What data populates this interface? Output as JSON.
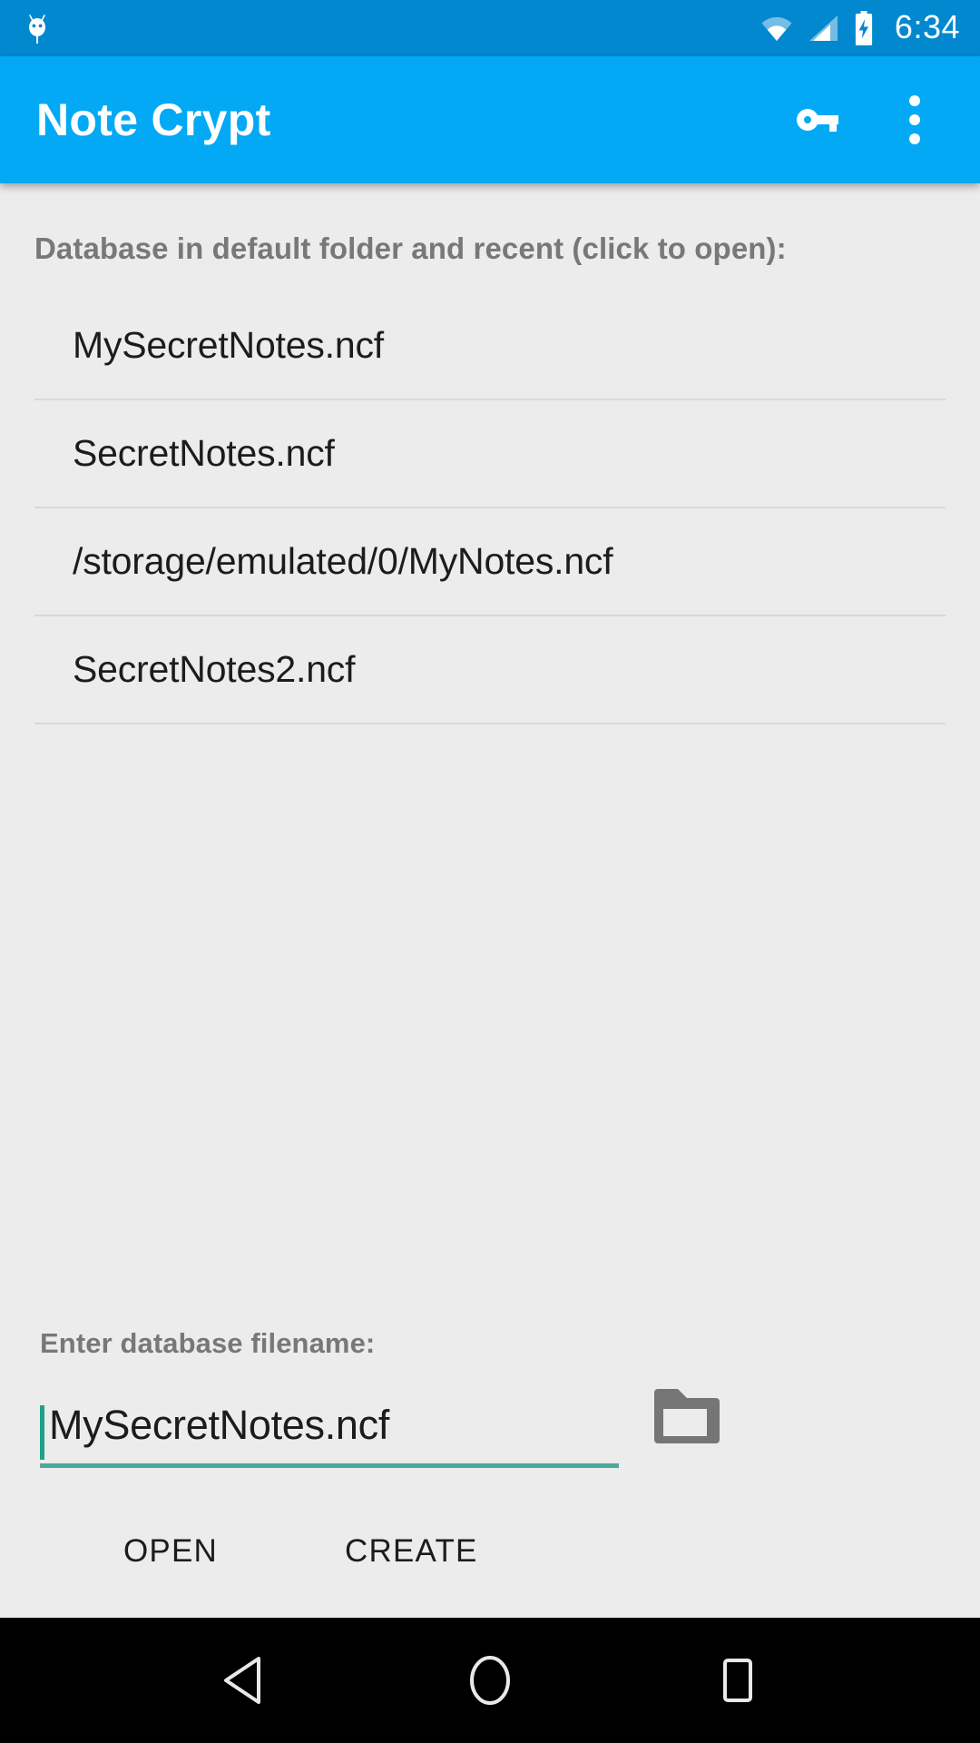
{
  "status_bar": {
    "background_color": "#0288CE",
    "notification_icon": "android-droid-icon",
    "wifi_icon": "wifi-icon",
    "signal_icon": "cellular-signal-icon",
    "battery_icon": "battery-charging-icon",
    "time": "6:34"
  },
  "app_bar": {
    "background_color": "#03A9F4",
    "title": "Note Crypt",
    "actions": [
      {
        "name": "key-icon",
        "label": "Key"
      },
      {
        "name": "overflow-menu-icon",
        "label": "More options"
      }
    ]
  },
  "main": {
    "background_color": "#ececec",
    "list_heading": "Database in default folder and recent (click to open):",
    "databases": [
      {
        "name": "MySecretNotes.ncf"
      },
      {
        "name": "SecretNotes.ncf"
      },
      {
        "name": "/storage/emulated/0/MyNotes.ncf"
      },
      {
        "name": "SecretNotes2.ncf"
      }
    ],
    "filename_field": {
      "label": "Enter database filename:",
      "value": "MySecretNotes.ncf",
      "placeholder": "Enter database filename",
      "underline_color": "#4da89a",
      "caret_color": "#22a08c"
    },
    "browse_icon": "folder-icon",
    "buttons": [
      {
        "label": "OPEN",
        "name": "open-button"
      },
      {
        "label": "CREATE",
        "name": "create-button"
      }
    ]
  },
  "nav_bar": {
    "background_color": "#000000",
    "buttons": [
      {
        "name": "nav-back-icon",
        "label": "Back"
      },
      {
        "name": "nav-home-icon",
        "label": "Home"
      },
      {
        "name": "nav-recents-icon",
        "label": "Recents"
      }
    ]
  }
}
